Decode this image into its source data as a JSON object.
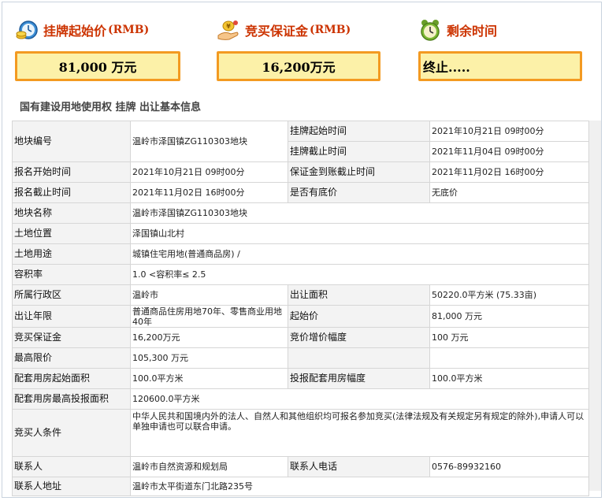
{
  "header": {
    "start_price": {
      "label": "挂牌起始价",
      "unit": "(RMB)",
      "value": "81,000 万元"
    },
    "deposit": {
      "label": "竞买保证金",
      "unit": "(RMB)",
      "value": "16,200万元"
    },
    "remaining": {
      "label": "剩余时间",
      "value": "终止....."
    }
  },
  "subtitle": "国有建设用地使用权 挂牌 出让基本信息",
  "rows": {
    "plot_no": {
      "label": "地块编号",
      "value": "温岭市泽国镇ZG110303地块"
    },
    "listing_start": {
      "label": "挂牌起始时间",
      "value": "2021年10月21日 09时00分"
    },
    "listing_end": {
      "label": "挂牌截止时间",
      "value": "2021年11月04日 09时00分"
    },
    "signup_start": {
      "label": "报名开始时间",
      "value": "2021年10月21日 09时00分"
    },
    "deposit_deadline": {
      "label": "保证金到账截止时间",
      "value": "2021年11月02日 16时00分"
    },
    "signup_end": {
      "label": "报名截止时间",
      "value": "2021年11月02日 16时00分"
    },
    "reserve_price": {
      "label": "是否有底价",
      "value": "无底价"
    },
    "plot_name": {
      "label": "地块名称",
      "value": "温岭市泽国镇ZG110303地块"
    },
    "location": {
      "label": "土地位置",
      "value": "泽国镇山北村"
    },
    "land_use": {
      "label": "土地用途",
      "value": "城镇住宅用地(普通商品房) /"
    },
    "far": {
      "label": "容积率",
      "value": "1.0 <容积率≤ 2.5"
    },
    "district": {
      "label": "所属行政区",
      "value": "温岭市"
    },
    "area": {
      "label": "出让面积",
      "value": "50220.0平方米 (75.33亩)"
    },
    "term": {
      "label": "出让年限",
      "value": "普通商品住房用地70年、零售商业用地40年"
    },
    "start_price": {
      "label": "起始价",
      "value": "81,000 万元"
    },
    "deposit": {
      "label": "竞买保证金",
      "value": "16,200万元"
    },
    "increment": {
      "label": "竞价增价幅度",
      "value": "100 万元"
    },
    "max_price": {
      "label": "最高限价",
      "value": "105,300 万元"
    },
    "housing_start": {
      "label": "配套用房起始面积",
      "value": "100.0平方米"
    },
    "housing_increment": {
      "label": "投报配套用房幅度",
      "value": "100.0平方米"
    },
    "housing_max": {
      "label": "配套用房最高投报面积",
      "value": "120600.0平方米"
    },
    "bidder_conditions": {
      "label": "竞买人条件",
      "value": "中华人民共和国境内外的法人、自然人和其他组织均可报名参加竞买(法律法规及有关规定另有规定的除外),申请人可以单独申请也可以联合申请。"
    },
    "contact": {
      "label": "联系人",
      "value": "温岭市自然资源和规划局"
    },
    "phone": {
      "label": "联系人电话",
      "value": "0576-89932160"
    },
    "address": {
      "label": "联系人地址",
      "value": "温岭市太平街道东门北路235号"
    }
  }
}
